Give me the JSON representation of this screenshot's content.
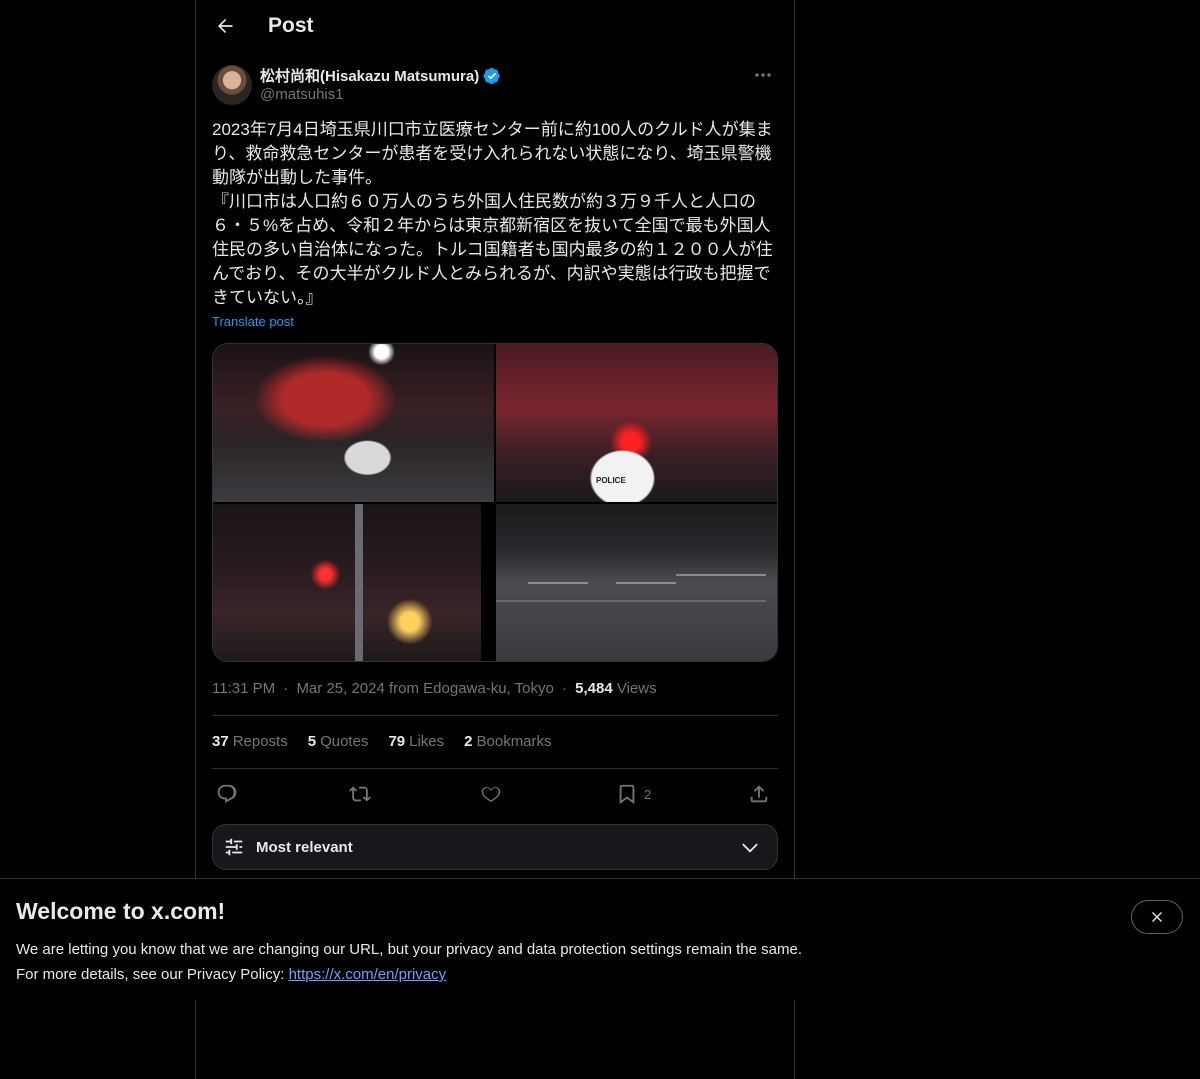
{
  "header": {
    "title": "Post",
    "back_icon": "arrow-left-icon"
  },
  "post": {
    "author": {
      "name": "松村尚和(Hisakazu Matsumura)",
      "handle": "@matsuhis1",
      "verified": true
    },
    "text": "2023年7月4日埼玉県川口市立医療センター前に約100人のクルド人が集まり、救命救急センターが患者を受け入れられない状態になり、埼玉県警機動隊が出動した事件。\n『川口市は人口約６０万人のうち外国人住民数が約３万９千人と人口の６・５%を占め、令和２年からは東京都新宿区を抜いて全国で最も外国人住民の多い自治体になった。トルコ国籍者も国内最多の約１２００人が住んでおり、その大半がクルド人とみられるが、内訳や実態は行政も把握できていない。』",
    "translate_label": "Translate post",
    "meta": {
      "time": "11:31 PM",
      "sep1": "·",
      "date_location": "Mar 25, 2024 from Edogawa-ku, Tokyo",
      "sep2": "·",
      "views_count": "5,484",
      "views_label": "Views"
    },
    "stats": {
      "reposts_count": "37",
      "reposts_label": "Reposts",
      "quotes_count": "5",
      "quotes_label": "Quotes",
      "likes_count": "79",
      "likes_label": "Likes",
      "bookmarks_count": "2",
      "bookmarks_label": "Bookmarks"
    },
    "actions": {
      "reply_icon": "reply-icon",
      "repost_icon": "repost-icon",
      "like_icon": "heart-icon",
      "bookmark_icon": "bookmark-icon",
      "bookmark_count": "2",
      "share_icon": "share-icon"
    },
    "media": {
      "tiles": [
        {
          "name": "police-car-crowd-photo"
        },
        {
          "name": "police-car-night-photo",
          "overlay_text": "POLICE"
        },
        {
          "name": "street-crowd-photo"
        },
        {
          "name": "road-intersection-photo"
        }
      ]
    }
  },
  "sort": {
    "label": "Most relevant",
    "icon": "sliders-icon"
  },
  "banner": {
    "title": "Welcome to x.com!",
    "line1": "We are letting you know that we are changing our URL, but your privacy and data protection settings remain the same.",
    "line2_prefix": "For more details, see our Privacy Policy: ",
    "link": "https://x.com/en/privacy"
  },
  "colors": {
    "background": "#000000",
    "text": "#e7e9ea",
    "muted": "#71767b",
    "accent": "#1d9bf0",
    "border": "#2f3336"
  }
}
